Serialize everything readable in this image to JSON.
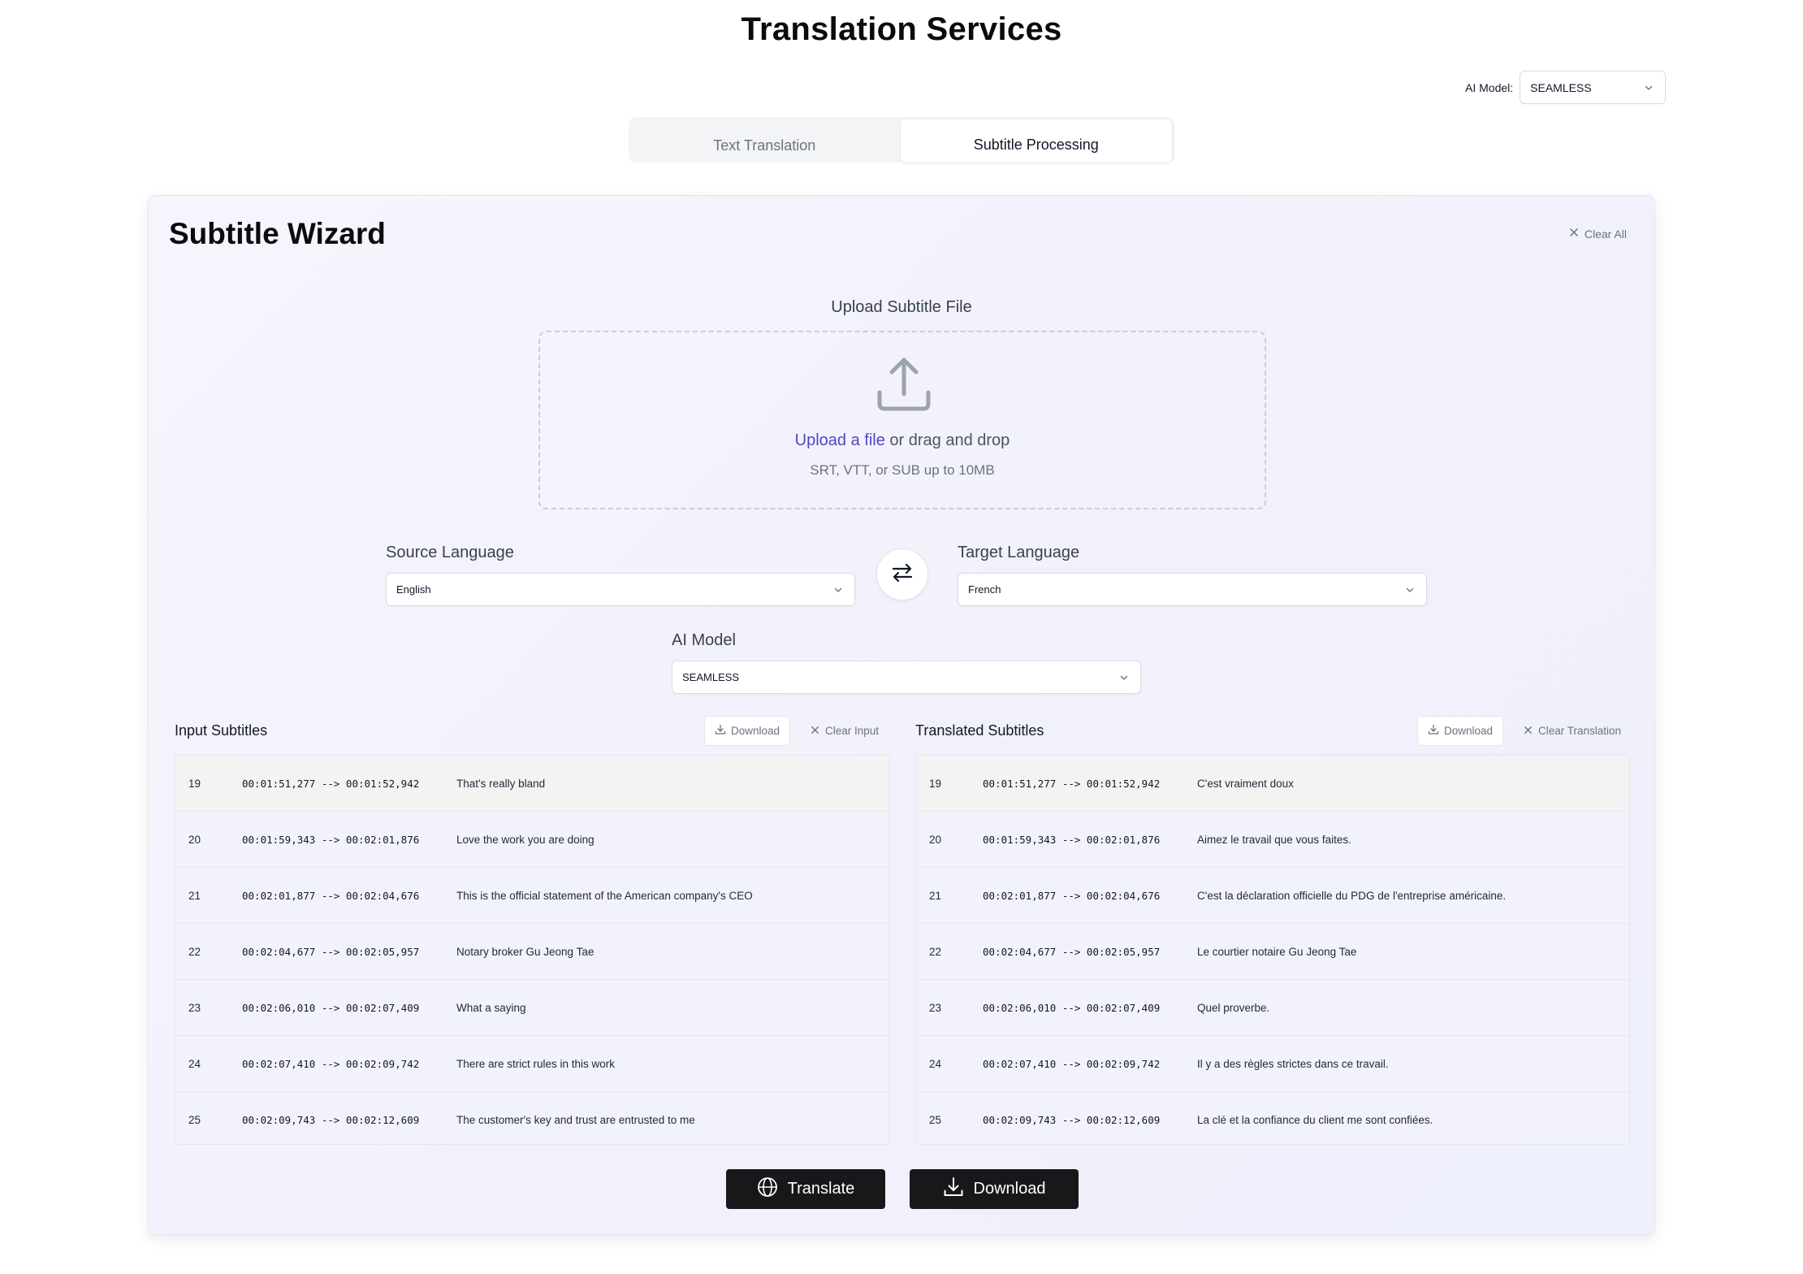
{
  "page": {
    "title": "Translation Services"
  },
  "top_model": {
    "label": "AI Model:",
    "value": "SEAMLESS"
  },
  "tabs": [
    {
      "label": "Text Translation",
      "active": false
    },
    {
      "label": "Subtitle Processing",
      "active": true
    }
  ],
  "wizard": {
    "title": "Subtitle Wizard",
    "clear_all": "Clear All",
    "upload": {
      "label": "Upload Subtitle File",
      "link": "Upload a file",
      "rest": "or drag and drop",
      "hint": "SRT, VTT, or SUB up to 10MB"
    },
    "source": {
      "label": "Source Language",
      "value": "English"
    },
    "target": {
      "label": "Target Language",
      "value": "French"
    },
    "model": {
      "label": "AI Model",
      "value": "SEAMLESS"
    },
    "input": {
      "title": "Input Subtitles",
      "download": "Download",
      "clear": "Clear Input",
      "rows": [
        {
          "num": "19",
          "time": "00:01:51,277 --> 00:01:52,942",
          "text": "That's really bland"
        },
        {
          "num": "20",
          "time": "00:01:59,343 --> 00:02:01,876",
          "text": "Love the work you are doing"
        },
        {
          "num": "21",
          "time": "00:02:01,877 --> 00:02:04,676",
          "text": "This is the official statement of the American company's CEO"
        },
        {
          "num": "22",
          "time": "00:02:04,677 --> 00:02:05,957",
          "text": "Notary broker Gu Jeong Tae"
        },
        {
          "num": "23",
          "time": "00:02:06,010 --> 00:02:07,409",
          "text": "What a saying"
        },
        {
          "num": "24",
          "time": "00:02:07,410 --> 00:02:09,742",
          "text": "There are strict rules in this work"
        },
        {
          "num": "25",
          "time": "00:02:09,743 --> 00:02:12,609",
          "text": "The customer's key and trust are entrusted to me"
        }
      ]
    },
    "output": {
      "title": "Translated Subtitles",
      "download": "Download",
      "clear": "Clear Translation",
      "rows": [
        {
          "num": "19",
          "time": "00:01:51,277 --> 00:01:52,942",
          "text": "C'est vraiment doux"
        },
        {
          "num": "20",
          "time": "00:01:59,343 --> 00:02:01,876",
          "text": "Aimez le travail que vous faites."
        },
        {
          "num": "21",
          "time": "00:02:01,877 --> 00:02:04,676",
          "text": "C'est la déclaration officielle du PDG de l'entreprise américaine."
        },
        {
          "num": "22",
          "time": "00:02:04,677 --> 00:02:05,957",
          "text": "Le courtier notaire Gu Jeong Tae"
        },
        {
          "num": "23",
          "time": "00:02:06,010 --> 00:02:07,409",
          "text": "Quel proverbe."
        },
        {
          "num": "24",
          "time": "00:02:07,410 --> 00:02:09,742",
          "text": "Il y a des règles strictes dans ce travail."
        },
        {
          "num": "25",
          "time": "00:02:09,743 --> 00:02:12,609",
          "text": "La clé et la confiance du client me sont confiées."
        }
      ]
    },
    "translate_button": "Translate",
    "download_button": "Download"
  },
  "icons": {
    "chevron": "chevron-down-icon",
    "upload": "upload-icon",
    "swap": "swap-arrows-icon",
    "download": "download-icon",
    "close": "close-icon",
    "globe": "globe-icon"
  },
  "colors": {
    "accent_link": "#4f46c5",
    "primary_button": "#18181b"
  }
}
